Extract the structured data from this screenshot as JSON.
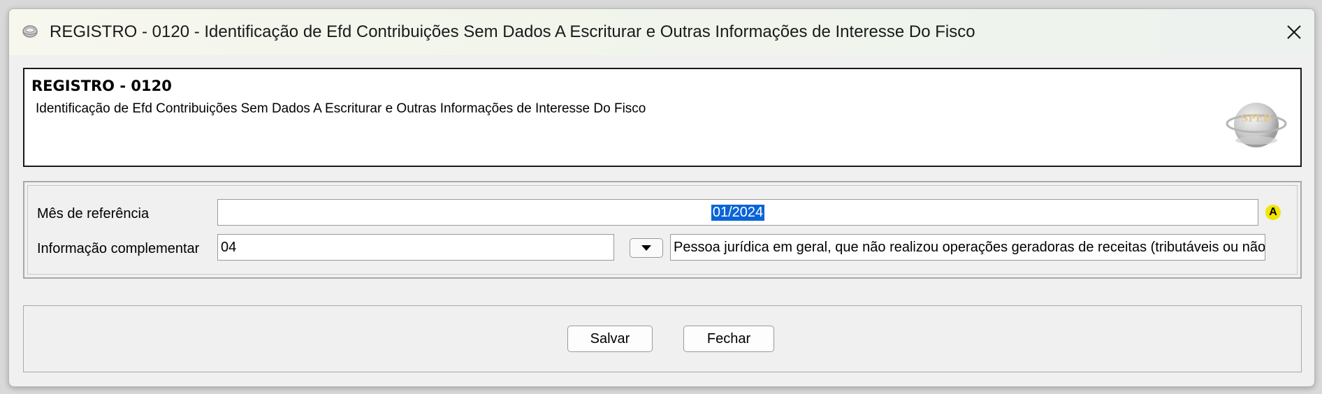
{
  "window": {
    "title": "REGISTRO - 0120 - Identificação de Efd Contribuições Sem Dados A Escriturar e Outras Informações de Interesse Do Fisco"
  },
  "header": {
    "register": "REGISTRO - 0120",
    "description": "Identificação de Efd Contribuições Sem Dados A Escriturar e Outras Informações de Interesse Do Fisco",
    "logo_text": "SPED"
  },
  "form": {
    "mes_referencia": {
      "label": "Mês de referência",
      "value": "01/2024",
      "badge": "A"
    },
    "informacao_complementar": {
      "label": "Informação complementar",
      "code": "04",
      "description": "Pessoa jurídica em geral, que não realizou operações geradoras de receitas (tributáveis ou não)"
    }
  },
  "buttons": {
    "save": "Salvar",
    "close": "Fechar"
  },
  "icons": {
    "app": "gear-icon",
    "close": "close-icon",
    "dropdown": "triangle-down-icon"
  }
}
